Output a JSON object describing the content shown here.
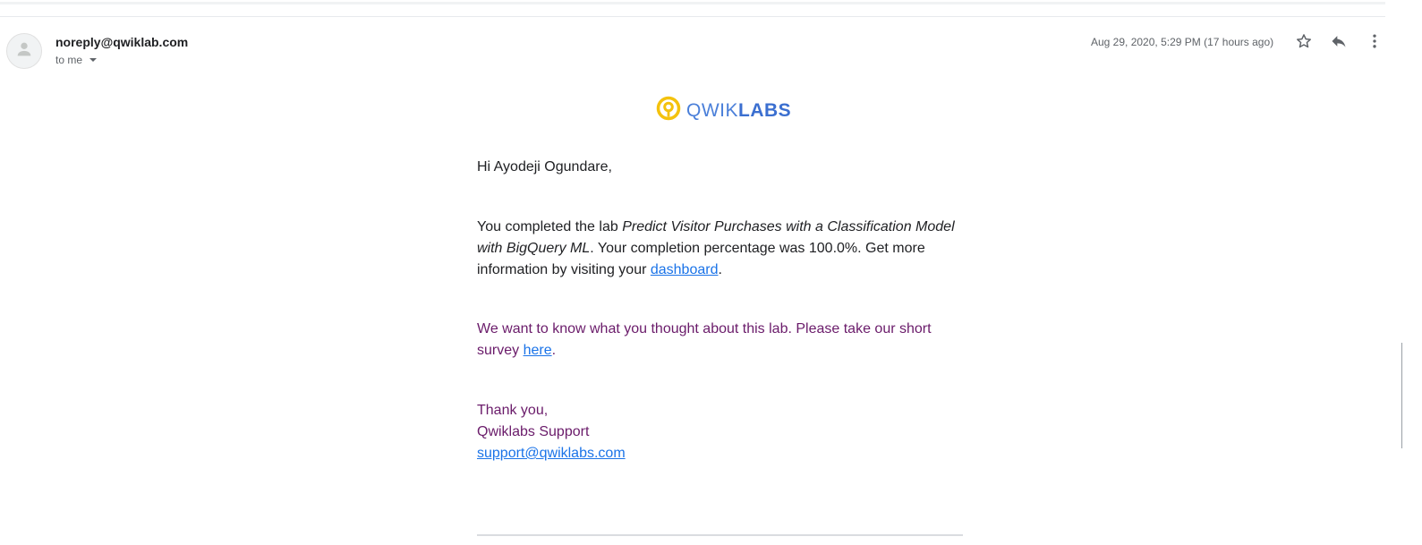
{
  "header": {
    "sender": "noreply@qwiklab.com",
    "recipient_label": "to me",
    "date": "Aug 29, 2020, 5:29 PM (17 hours ago)"
  },
  "logo": {
    "part1": "QWIK",
    "part2": "LABS"
  },
  "email": {
    "greeting": "Hi Ayodeji Ogundare,",
    "completed_prefix": "You completed the lab ",
    "lab_title": "Predict Visitor Purchases with a Classification Model with BigQuery ML",
    "completed_suffix": ". Your completion percentage was 100.0%. Get more information by visiting your ",
    "dashboard_link": "dashboard",
    "period": ".",
    "survey_text": "We want to know what you thought about this lab. Please take our short survey ",
    "survey_link": "here",
    "thanks": "Thank you,",
    "signature": "Qwiklabs Support",
    "support_email": "support@qwiklabs.com"
  },
  "icons": {
    "avatar": "person-icon",
    "star": "star-icon",
    "reply": "reply-icon",
    "more": "more-vert-icon"
  },
  "colors": {
    "link": "#1a73e8",
    "purple_text": "#6a1b6a",
    "logo_yellow": "#f4c20d",
    "logo_blue": "#4a7fd9"
  }
}
